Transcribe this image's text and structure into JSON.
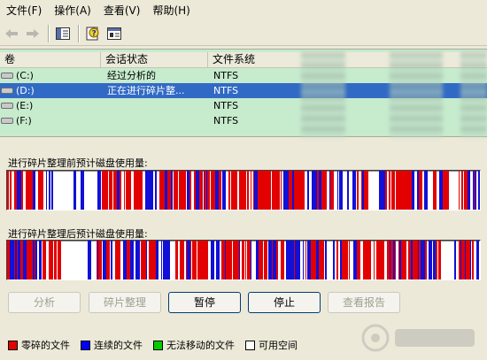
{
  "menu": [
    {
      "label": "文件(F)",
      "name": "menu-file"
    },
    {
      "label": "操作(A)",
      "name": "menu-action"
    },
    {
      "label": "查看(V)",
      "name": "menu-view"
    },
    {
      "label": "帮助(H)",
      "name": "menu-help"
    }
  ],
  "list": {
    "columns": [
      "卷",
      "会话状态",
      "文件系统"
    ],
    "rows": [
      {
        "volume": "(C:)",
        "status": "经过分析的",
        "fs": "NTFS",
        "selected": false
      },
      {
        "volume": "(D:)",
        "status": "正在进行碎片整...",
        "fs": "NTFS",
        "selected": true
      },
      {
        "volume": "(E:)",
        "status": "",
        "fs": "NTFS",
        "selected": false
      },
      {
        "volume": "(F:)",
        "status": "",
        "fs": "NTFS",
        "selected": false
      }
    ]
  },
  "before_label": "进行碎片整理前预计磁盘使用量:",
  "after_label": "进行碎片整理后预计磁盘使用量:",
  "buttons": {
    "analyze": "分析",
    "defrag": "碎片整理",
    "pause": "暂停",
    "stop": "停止",
    "report": "查看报告"
  },
  "legend": [
    {
      "label": "零碎的文件",
      "color": "#e20000"
    },
    {
      "label": "连续的文件",
      "color": "#0000ff"
    },
    {
      "label": "无法移动的文件",
      "color": "#00cc00"
    },
    {
      "label": "可用空间",
      "color": "#ffffff"
    }
  ],
  "colors": {
    "fragmented": "#e20000",
    "contiguous": "#1010d8",
    "free": "#ffffff",
    "selection": "#316ac5",
    "list_bg": "#c6ebcd"
  }
}
